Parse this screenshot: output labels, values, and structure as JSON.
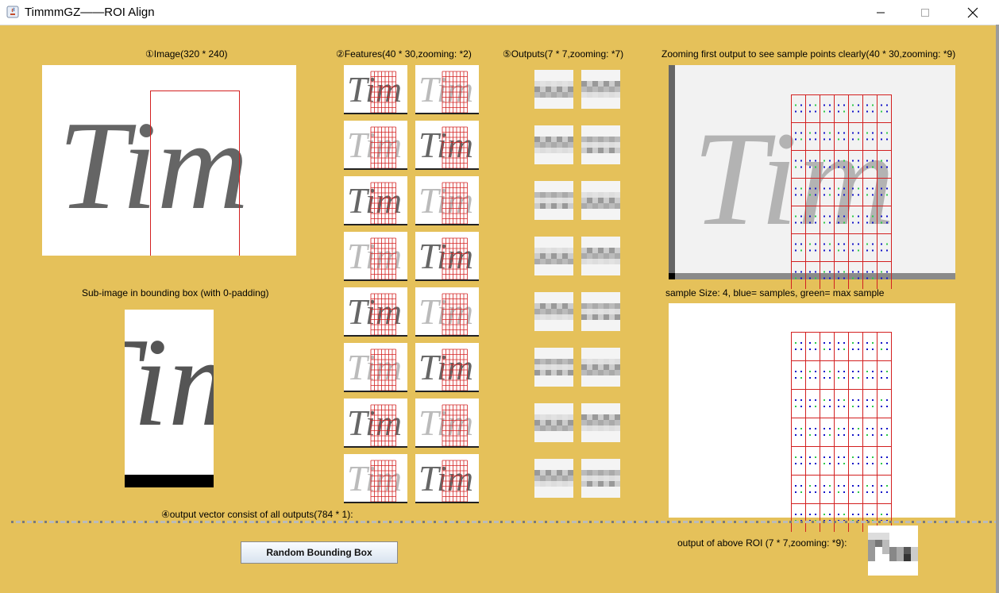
{
  "window": {
    "title": "TimmmGZ——ROI Align"
  },
  "labels": {
    "image": "①Image(320 * 240)",
    "features": "②Features(40 * 30,zooming: *2)",
    "outputs": "⑤Outputs(7 * 7,zooming: *7)",
    "zooming": "Zooming first output to see sample points clearly(40 * 30,zooming: *9)",
    "subimage": "Sub-image in bounding box (with 0-padding)",
    "sample_info": "sample Size: 4, blue= samples, green= max sample",
    "output_vector": "④output vector consist of all outputs(784 * 1):",
    "roi_output": "output of above ROI (7 * 7,zooming: *9):"
  },
  "button": {
    "random_bbox": "Random Bounding Box"
  },
  "image_text": "Tim",
  "colors": {
    "background": "#e5c15a",
    "roi_grid": "#d32020",
    "sample_blue": "#1414c8",
    "max_green": "#2ec84a"
  },
  "icons": [
    "java-icon",
    "minimize-icon",
    "maximize-icon",
    "close-icon"
  ]
}
